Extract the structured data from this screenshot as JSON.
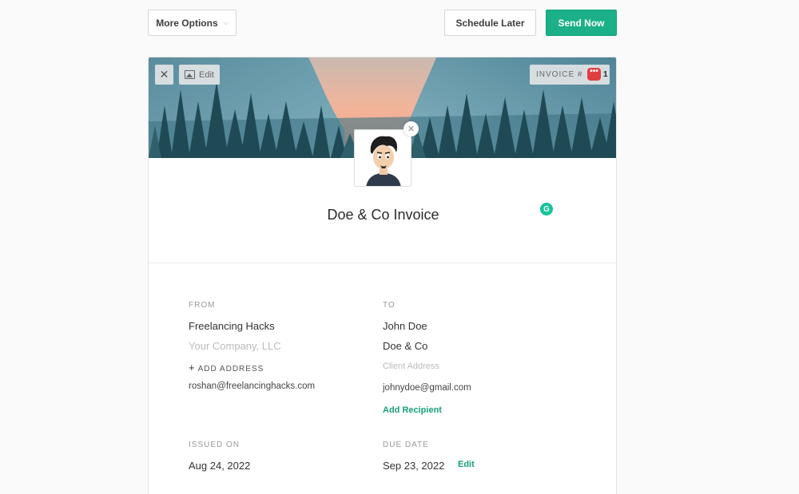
{
  "toolbar": {
    "more_options": "More Options",
    "schedule_later": "Schedule Later",
    "send_now": "Send Now"
  },
  "banner": {
    "edit_label": "Edit",
    "invoice_label": "INVOICE #",
    "invoice_number_visible": "1",
    "invoice_number_end": "1",
    "badge_icon": "more-dots-icon"
  },
  "invoice": {
    "title": "Doe & Co Invoice"
  },
  "from": {
    "label": "FROM",
    "name": "Freelancing Hacks",
    "company_placeholder": "Your Company, LLC",
    "add_address": "ADD ADDRESS",
    "email": "roshan@freelancinghacks.com"
  },
  "to": {
    "label": "TO",
    "name": "John Doe",
    "company": "Doe & Co",
    "address_placeholder": "Client Address",
    "email": "johnydoe@gmail.com",
    "add_recipient": "Add Recipient"
  },
  "dates": {
    "issued_label": "ISSUED ON",
    "issued_value": "Aug 24, 2022",
    "due_label": "DUE DATE",
    "due_value": "Sep 23, 2022",
    "due_edit": "Edit"
  },
  "colors": {
    "accent": "#1bb088",
    "badge_red": "#e03f3f",
    "grammarly": "#15c39a"
  }
}
